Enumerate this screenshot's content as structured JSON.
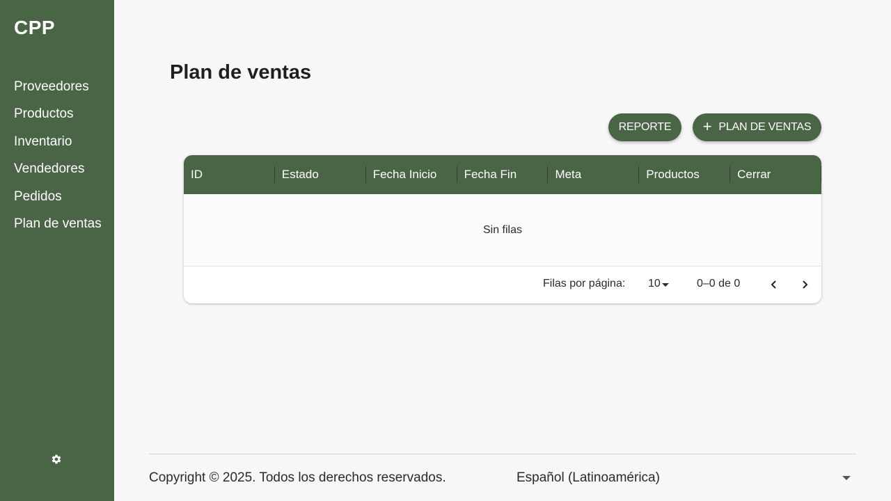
{
  "app": {
    "logo": "CPP"
  },
  "sidebar": {
    "items": [
      {
        "label": "Proveedores"
      },
      {
        "label": "Productos"
      },
      {
        "label": "Inventario"
      },
      {
        "label": "Vendedores"
      },
      {
        "label": "Pedidos"
      },
      {
        "label": "Plan de ventas"
      }
    ],
    "settings_icon": "gear-icon"
  },
  "page": {
    "title": "Plan de ventas"
  },
  "actions": {
    "report_label": "REPORTE",
    "add_plan_label": "PLAN DE VENTAS",
    "add_icon": "plus-icon"
  },
  "table": {
    "columns": [
      "ID",
      "Estado",
      "Fecha Inicio",
      "Fecha Fin",
      "Meta",
      "Productos",
      "Cerrar"
    ],
    "rows": [],
    "empty_text": "Sin filas",
    "pagination": {
      "rows_per_page_label": "Filas por página:",
      "rows_per_page": "10",
      "range_text": "0–0 de 0"
    }
  },
  "footer": {
    "copyright": "Copyright © 2025. Todos los derechos reservados.",
    "language": "Español (Latinoamérica)"
  },
  "colors": {
    "primary": "#4a6446",
    "background": "#f7f7f7",
    "text": "#1f1f1f"
  }
}
